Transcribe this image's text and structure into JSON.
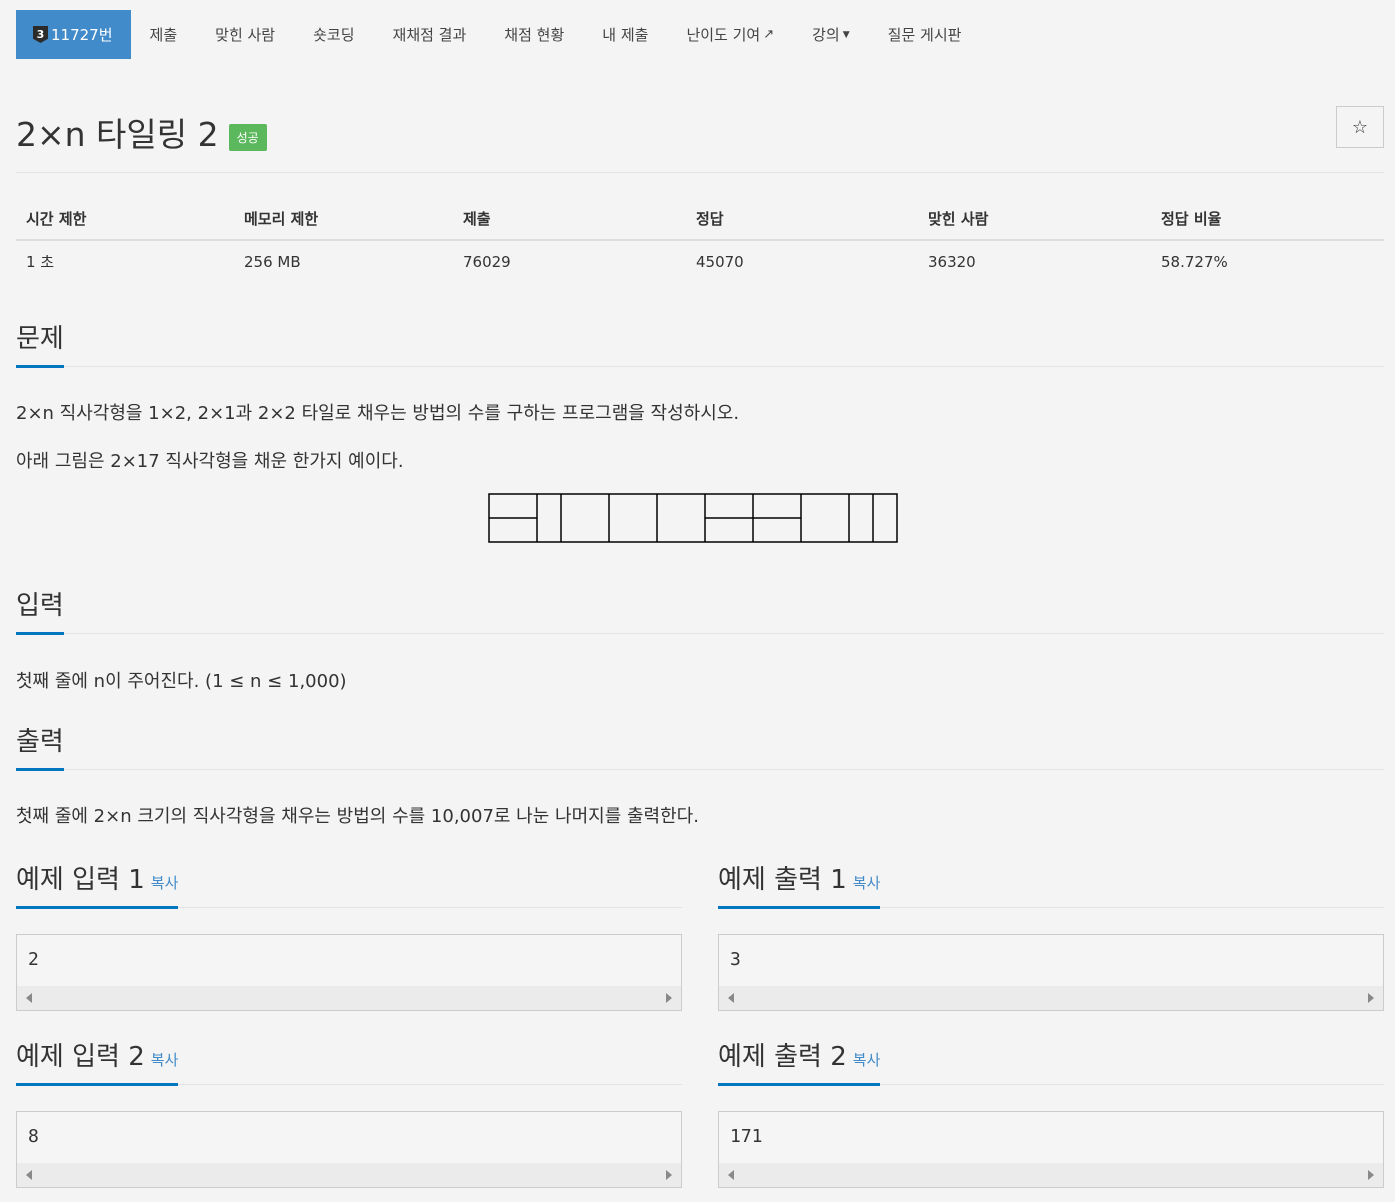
{
  "nav": {
    "problem_badge": "3",
    "problem_label": "11727번",
    "items": [
      "제출",
      "맞힌 사람",
      "숏코딩",
      "재채점 결과",
      "채점 현황",
      "내 제출",
      "난이도 기여",
      "강의",
      "질문 게시판"
    ]
  },
  "problem": {
    "title": "2×n 타일링 2",
    "status": "성공",
    "star_icon": "☆"
  },
  "info": {
    "headers": [
      "시간 제한",
      "메모리 제한",
      "제출",
      "정답",
      "맞힌 사람",
      "정답 비율"
    ],
    "values": [
      "1 초",
      "256 MB",
      "76029",
      "45070",
      "36320",
      "58.727%"
    ]
  },
  "sections": {
    "problem_head": "문제",
    "problem_text_1": "2×n 직사각형을 1×2, 2×1과 2×2 타일로 채우는 방법의 수를 구하는 프로그램을 작성하시오.",
    "problem_text_2": "아래 그림은 2×17 직사각형을 채운 한가지 예이다.",
    "input_head": "입력",
    "input_text": "첫째 줄에 n이 주어진다. (1 ≤ n ≤ 1,000)",
    "output_head": "출력",
    "output_text": "첫째 줄에 2×n 크기의 직사각형을 채우는 방법의 수를 10,007로 나눈 나머지를 출력한다."
  },
  "samples": {
    "copy_label": "복사",
    "in1_head": "예제 입력 1",
    "out1_head": "예제 출력 1",
    "in2_head": "예제 입력 2",
    "out2_head": "예제 출력 2",
    "in1": "2",
    "out1": "3",
    "in2": "8",
    "out2": "171"
  },
  "colors": {
    "accent": "#428bca",
    "success": "#5cb85c",
    "section_underline": "#0076c0"
  }
}
